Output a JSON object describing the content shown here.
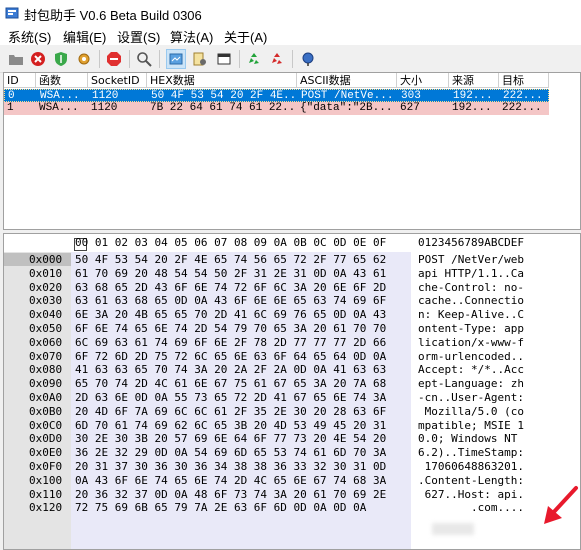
{
  "title": "封包助手 V0.6 Beta Build 0306",
  "menu": [
    "系统(S)",
    "编辑(E)",
    "设置(S)",
    "算法(A)",
    "关于(A)"
  ],
  "toolbar_icons": [
    "folder-icon",
    "stop-icon",
    "shield-icon",
    "gear-icon",
    "stop-sign-icon",
    "search-icon",
    "capture-icon",
    "settings-icon",
    "window-icon",
    "recycle-green-icon",
    "recycle-red-icon",
    "pin-icon"
  ],
  "list": {
    "columns": [
      "ID",
      "函数",
      "SocketID",
      "HEX数据",
      "ASCII数据",
      "大小",
      "来源",
      "目标"
    ],
    "rows": [
      {
        "id": "0",
        "func": "WSA...",
        "socket": "1120",
        "hex": "50 4F 53 54 20 2F 4E...",
        "ascii": "POST /NetVe...",
        "size": "303",
        "src": "192...",
        "dst": "222...",
        "style": "selected"
      },
      {
        "id": "1",
        "func": "WSA...",
        "socket": "1120",
        "hex": "7B 22 64 61 74 61 22...",
        "ascii": "{\"data\":\"2B...",
        "size": "627",
        "src": "192...",
        "dst": "222...",
        "style": "pink"
      }
    ]
  },
  "hex": {
    "header": "00 01 02 03 04 05 06 07 08 09 0A 0B 0C 0D 0E 0F",
    "ascii_header": "0123456789ABCDEF",
    "offsets": [
      "0x000",
      "0x010",
      "0x020",
      "0x030",
      "0x040",
      "0x050",
      "0x060",
      "0x070",
      "0x080",
      "0x090",
      "0x0A0",
      "0x0B0",
      "0x0C0",
      "0x0D0",
      "0x0E0",
      "0x0F0",
      "0x100",
      "0x110",
      "0x120"
    ],
    "lines": [
      "50 4F 53 54 20 2F 4E 65 74 56 65 72 2F 77 65 62",
      "61 70 69 20 48 54 54 50 2F 31 2E 31 0D 0A 43 61",
      "63 68 65 2D 43 6F 6E 74 72 6F 6C 3A 20 6E 6F 2D",
      "63 61 63 68 65 0D 0A 43 6F 6E 6E 65 63 74 69 6F",
      "6E 3A 20 4B 65 65 70 2D 41 6C 69 76 65 0D 0A 43",
      "6F 6E 74 65 6E 74 2D 54 79 70 65 3A 20 61 70 70",
      "6C 69 63 61 74 69 6F 6E 2F 78 2D 77 77 77 2D 66",
      "6F 72 6D 2D 75 72 6C 65 6E 63 6F 64 65 64 0D 0A",
      "41 63 63 65 70 74 3A 20 2A 2F 2A 0D 0A 41 63 63",
      "65 70 74 2D 4C 61 6E 67 75 61 67 65 3A 20 7A 68",
      "2D 63 6E 0D 0A 55 73 65 72 2D 41 67 65 6E 74 3A",
      "20 4D 6F 7A 69 6C 6C 61 2F 35 2E 30 20 28 63 6F",
      "6D 70 61 74 69 62 6C 65 3B 20 4D 53 49 45 20 31",
      "30 2E 30 3B 20 57 69 6E 64 6F 77 73 20 4E 54 20",
      "36 2E 32 29 0D 0A 54 69 6D 65 53 74 61 6D 70 3A",
      "20 31 37 30 36 30 36 34 38 38 36 33 32 30 31 0D",
      "0A 43 6F 6E 74 65 6E 74 2D 4C 65 6E 67 74 68 3A",
      "20 36 32 37 0D 0A 48 6F 73 74 3A 20 61 70 69 2E",
      "72 75 69 6B 65 79 7A 2E 63 6F 6D 0D 0A 0D 0A"
    ],
    "ascii": [
      "POST /NetVer/web",
      "api HTTP/1.1..Ca",
      "che-Control: no-",
      "cache..Connectio",
      "n: Keep-Alive..C",
      "ontent-Type: app",
      "lication/x-www-f",
      "orm-urlencoded..",
      "Accept: */*..Acc",
      "ept-Language: zh",
      "-cn..User-Agent:",
      " Mozilla/5.0 (co",
      "mpatible; MSIE 1",
      "0.0; Windows NT ",
      "6.2)..TimeStamp:",
      " 17060648863201.",
      ".Content-Length:",
      " 627..Host: api.",
      "        .com...."
    ]
  },
  "colors": {
    "selection": "#0078d7",
    "pink_row": "#f4c6c6",
    "hex_bg": "#e9e9f8",
    "offset_bg": "#e4e4e4",
    "arrow": "#e8192c"
  }
}
